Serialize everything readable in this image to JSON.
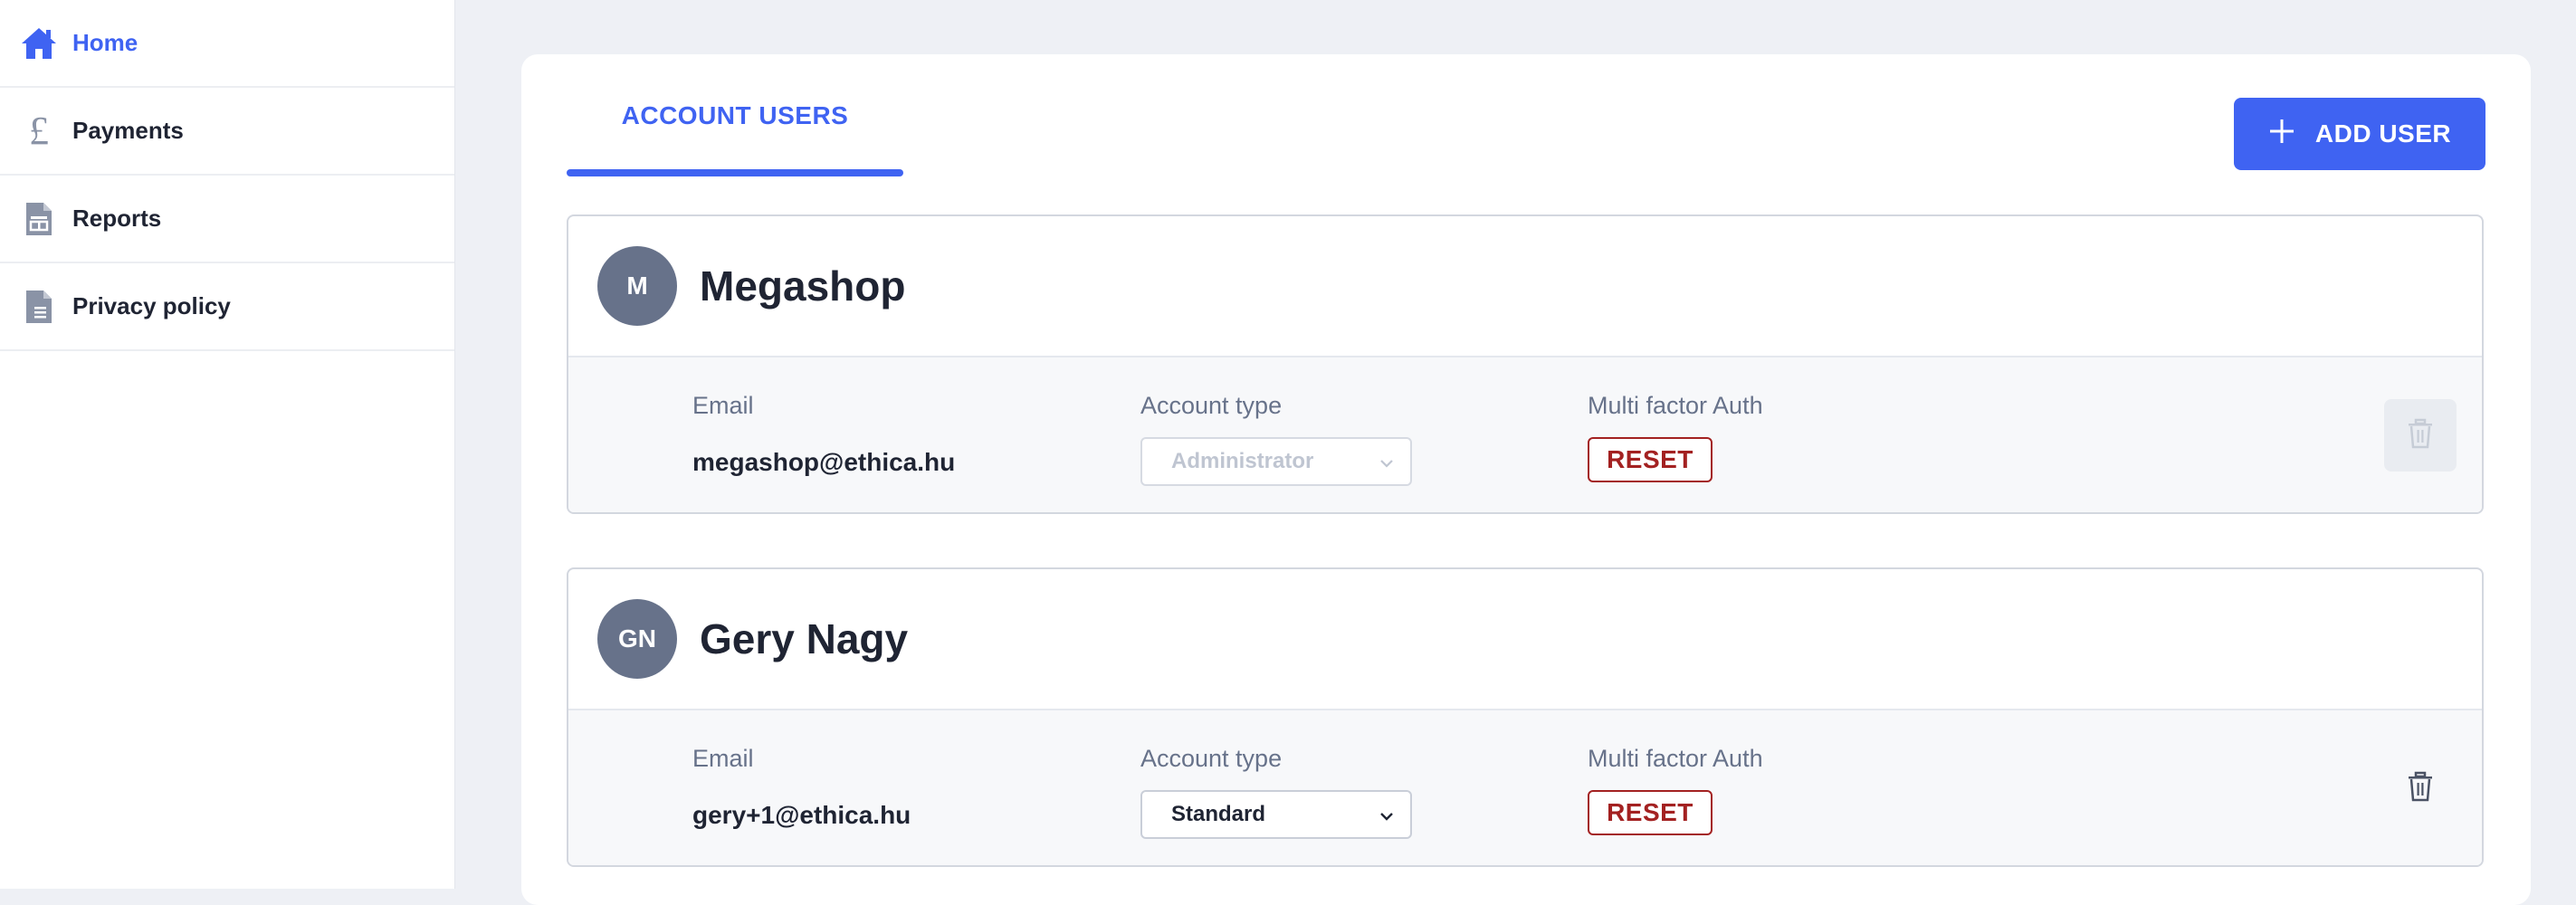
{
  "sidebar": {
    "items": [
      {
        "label": "Home",
        "icon": "home-icon",
        "active": true
      },
      {
        "label": "Payments",
        "icon": "pound-icon"
      },
      {
        "label": "Reports",
        "icon": "report-icon"
      },
      {
        "label": "Privacy policy",
        "icon": "document-icon"
      }
    ]
  },
  "main": {
    "tab_label": "ACCOUNT USERS",
    "add_user_label": "ADD USER",
    "users": [
      {
        "initials": "M",
        "name": "Megashop",
        "email_label": "Email",
        "email": "megashop@ethica.hu",
        "account_type_label": "Account type",
        "account_type": "Administrator",
        "account_type_disabled": true,
        "mfa_label": "Multi factor Auth",
        "reset_label": "RESET",
        "delete_disabled": true
      },
      {
        "initials": "GN",
        "name": "Gery Nagy",
        "email_label": "Email",
        "email": "gery+1@ethica.hu",
        "account_type_label": "Account type",
        "account_type": "Standard",
        "account_type_disabled": false,
        "mfa_label": "Multi factor Auth",
        "reset_label": "RESET",
        "delete_disabled": false
      }
    ]
  },
  "colors": {
    "accent": "#3f63f2",
    "danger": "#a32121",
    "avatar": "#67728a",
    "page_bg": "#eef0f5"
  }
}
